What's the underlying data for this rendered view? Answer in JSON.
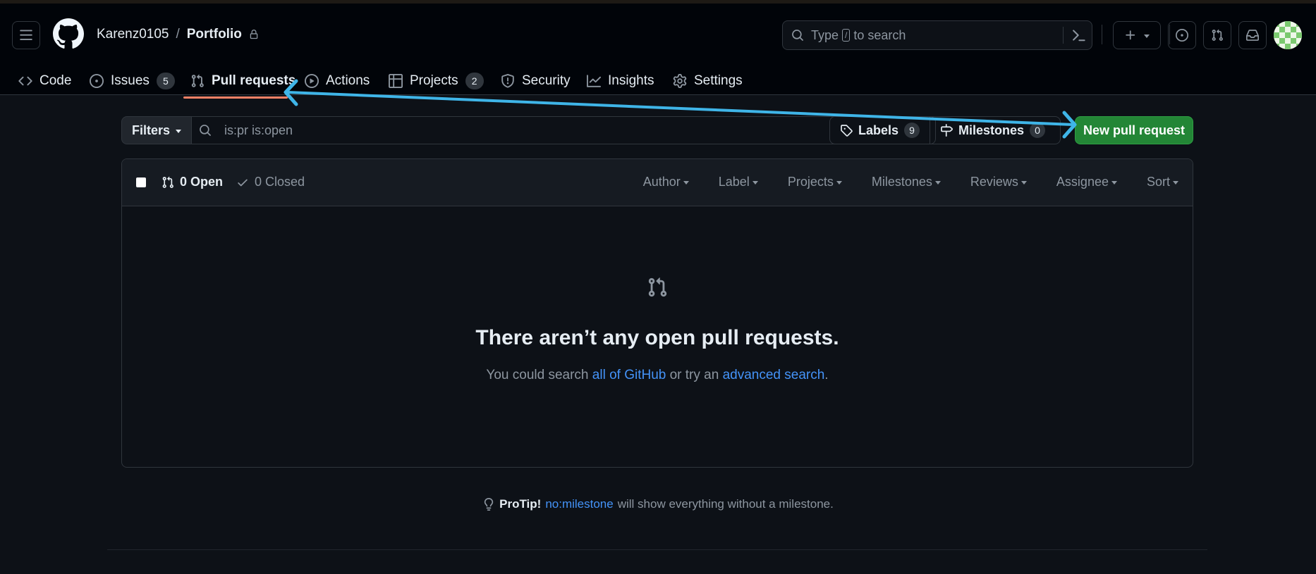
{
  "header": {
    "owner": "Karenz0105",
    "separator": "/",
    "repo": "Portfolio",
    "search": {
      "prefix": "Type",
      "key": "/",
      "suffix": "to search"
    }
  },
  "tabs": [
    {
      "label": "Code",
      "icon": "code-icon"
    },
    {
      "label": "Issues",
      "icon": "issue-opened-icon",
      "count": "5"
    },
    {
      "label": "Pull requests",
      "icon": "git-pull-request-icon",
      "active": true
    },
    {
      "label": "Actions",
      "icon": "play-icon"
    },
    {
      "label": "Projects",
      "icon": "table-icon",
      "count": "2"
    },
    {
      "label": "Security",
      "icon": "shield-icon"
    },
    {
      "label": "Insights",
      "icon": "graph-icon"
    },
    {
      "label": "Settings",
      "icon": "gear-icon"
    }
  ],
  "filters": {
    "button_label": "Filters",
    "query": "is:pr is:open"
  },
  "labels": {
    "label": "Labels",
    "count": "9"
  },
  "milestones": {
    "label": "Milestones",
    "count": "0"
  },
  "new_pr_label": "New pull request",
  "list_header": {
    "open": "0 Open",
    "closed": "0 Closed",
    "sorters": [
      "Author",
      "Label",
      "Projects",
      "Milestones",
      "Reviews",
      "Assignee",
      "Sort"
    ]
  },
  "blankslate": {
    "title": "There aren’t any open pull requests.",
    "text_before": "You could search ",
    "link1": "all of GitHub",
    "text_middle": " or try an ",
    "link2": "advanced search",
    "text_after": "."
  },
  "protip": {
    "label": "ProTip!",
    "link": "no:milestone",
    "text": "will show everything without a milestone."
  },
  "colors": {
    "background": "#0d1117",
    "header_bg": "#010409",
    "primary_button": "#238636",
    "link": "#4493f8",
    "tab_underline": "#f78166",
    "annotation_arrow": "#3fb5e8"
  }
}
